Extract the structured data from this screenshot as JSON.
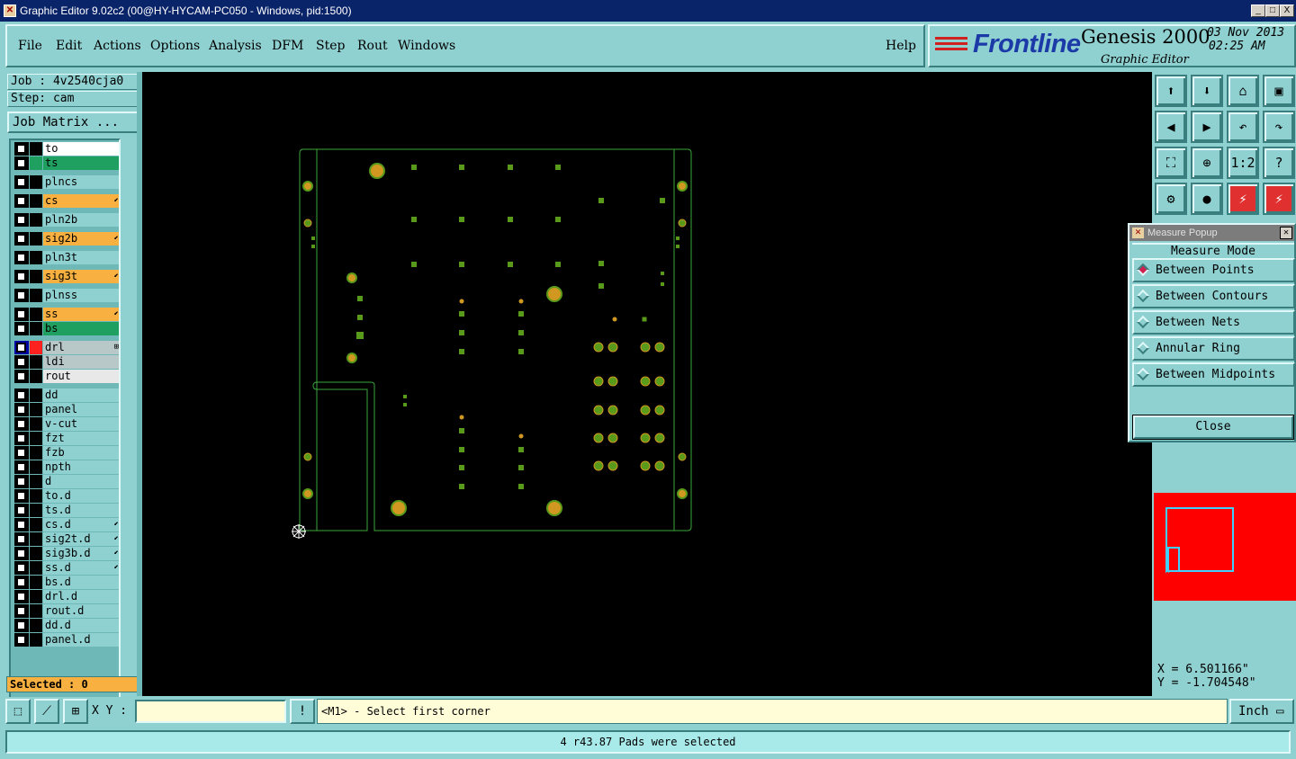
{
  "window": {
    "title": "Graphic Editor 9.02c2 (00@HY-HYCAM-PC050 - Windows, pid:1500)",
    "controls": {
      "minimize": "_",
      "maximize": "□",
      "close": "X"
    }
  },
  "menu": [
    "File",
    "Edit",
    "Actions",
    "Options",
    "Analysis",
    "DFM",
    "Step",
    "Rout",
    "Windows"
  ],
  "help_label": "Help",
  "brand": {
    "logo": "Frontline",
    "product": "Genesis 2000",
    "subtitle": "Graphic Editor",
    "date": "03 Nov 2013",
    "time": "02:25 AM"
  },
  "job": {
    "label": "Job : 4v2540cja0",
    "step": "Step: cam",
    "matrix_button": "Job Matrix ..."
  },
  "layers": [
    {
      "name": "to",
      "color": "#ffffff",
      "swatch": "#000000"
    },
    {
      "name": "ts",
      "color": "#20a060",
      "swatch": "#20a060"
    },
    {
      "name": "plncs",
      "color": "#8fd0d0",
      "swatch": "#000000"
    },
    {
      "name": "cs",
      "color": "#f8b040",
      "swatch": "#000000",
      "mark": "⬋"
    },
    {
      "name": "pln2b",
      "color": "#8fd0d0",
      "swatch": "#000000"
    },
    {
      "name": "sig2b",
      "color": "#f8b040",
      "swatch": "#000000",
      "mark": "⬋"
    },
    {
      "name": "pln3t",
      "color": "#8fd0d0",
      "swatch": "#000000"
    },
    {
      "name": "sig3t",
      "color": "#f8b040",
      "swatch": "#000000",
      "mark": "⬋"
    },
    {
      "name": "plnss",
      "color": "#8fd0d0",
      "swatch": "#000000"
    },
    {
      "name": "ss",
      "color": "#f8b040",
      "swatch": "#000000",
      "mark": "⬋"
    },
    {
      "name": "bs",
      "color": "#20a060",
      "swatch": "#000000"
    },
    {
      "name": "drl",
      "color": "#b8c8c8",
      "swatch": "#ff2020",
      "mark": "⊞",
      "checked": true
    },
    {
      "name": "ldi",
      "color": "#b8c8c8",
      "swatch": "#000000"
    },
    {
      "name": "rout",
      "color": "#e8e8e8",
      "swatch": "#000000"
    },
    {
      "name": "dd",
      "color": "#8fd0d0",
      "swatch": "#000000"
    },
    {
      "name": "panel",
      "color": "#8fd0d0",
      "swatch": "#000000"
    },
    {
      "name": "v-cut",
      "color": "#8fd0d0",
      "swatch": "#000000"
    },
    {
      "name": "fzt",
      "color": "#8fd0d0",
      "swatch": "#000000"
    },
    {
      "name": "fzb",
      "color": "#8fd0d0",
      "swatch": "#000000"
    },
    {
      "name": "npth",
      "color": "#8fd0d0",
      "swatch": "#000000"
    },
    {
      "name": "d",
      "color": "#8fd0d0",
      "swatch": "#000000"
    },
    {
      "name": "to.d",
      "color": "#8fd0d0",
      "swatch": "#000000"
    },
    {
      "name": "ts.d",
      "color": "#8fd0d0",
      "swatch": "#000000"
    },
    {
      "name": "cs.d",
      "color": "#8fd0d0",
      "swatch": "#000000",
      "mark": "⬋"
    },
    {
      "name": "sig2t.d",
      "color": "#8fd0d0",
      "swatch": "#000000",
      "mark": "⬋"
    },
    {
      "name": "sig3b.d",
      "color": "#8fd0d0",
      "swatch": "#000000",
      "mark": "⬋"
    },
    {
      "name": "ss.d",
      "color": "#8fd0d0",
      "swatch": "#000000",
      "mark": "⬋"
    },
    {
      "name": "bs.d",
      "color": "#8fd0d0",
      "swatch": "#000000"
    },
    {
      "name": "drl.d",
      "color": "#8fd0d0",
      "swatch": "#000000"
    },
    {
      "name": "rout.d",
      "color": "#8fd0d0",
      "swatch": "#000000"
    },
    {
      "name": "dd.d",
      "color": "#8fd0d0",
      "swatch": "#000000"
    },
    {
      "name": "panel.d",
      "color": "#8fd0d0",
      "swatch": "#000000"
    }
  ],
  "selected": "Selected : 0",
  "toolbar_icons": [
    "zoom-home-icon",
    "zoom-down-icon",
    "home-icon",
    "window-icon",
    "pan-left-icon",
    "pan-right-icon",
    "undo-zoom-icon",
    "redo-zoom-icon",
    "fit-icon",
    "center-icon",
    "scale-1-2-icon",
    "help-icon",
    "tools-icon",
    "probe-icon",
    "net-left-icon",
    "net-right-icon"
  ],
  "toolbar_glyphs": [
    "⬆",
    "⬇",
    "⌂",
    "▣",
    "◀",
    "▶",
    "↶",
    "↷",
    "⛶",
    "⊕",
    "1:2",
    "?",
    "⚙",
    "●",
    "⚡",
    "⚡"
  ],
  "measure": {
    "title": "Measure Popup",
    "mode_label": "Measure Mode",
    "options": [
      "Between Points",
      "Between Contours",
      "Between Nets",
      "Annular Ring",
      "Between Midpoints"
    ],
    "selected": 0,
    "close_label": "Close"
  },
  "coords": {
    "x": "X = 6.501166\"",
    "y": "Y = -1.704548\""
  },
  "bottom": {
    "xy_label": "X Y :",
    "xy_value": "",
    "bang": "!",
    "prompt": "<M1> - Select first corner",
    "unit": "Inch ▭"
  },
  "status": "4 r43.87 Pads were selected",
  "colors": {
    "panel": "#8fd0d0",
    "canvas": "#000000",
    "outline": "#3aa63a",
    "pad_green": "#5a9a1a",
    "pad_gold": "#d09820"
  }
}
